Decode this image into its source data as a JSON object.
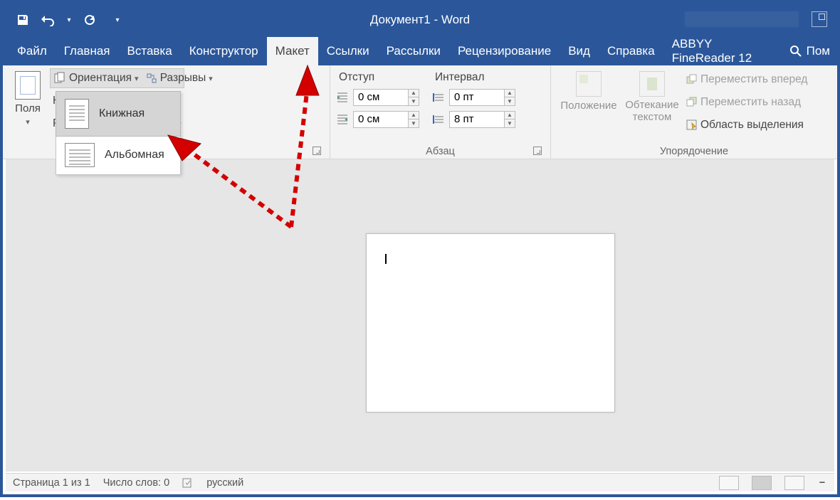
{
  "title": "Документ1  -  Word",
  "qat": {
    "save": "save",
    "undo": "undo",
    "redo": "redo"
  },
  "tabs": [
    "Файл",
    "Главная",
    "Вставка",
    "Конструктор",
    "Макет",
    "Ссылки",
    "Рассылки",
    "Рецензирование",
    "Вид",
    "Справка",
    "ABBYY FineReader 12"
  ],
  "active_tab_index": 4,
  "search_label": "Пом",
  "ribbon": {
    "page_setup": {
      "margins": "Поля",
      "orientation": "Ориентация",
      "breaks": "Разрывы",
      "line_numbers": "Номера строк",
      "hyphenation": "Расстановка переносов",
      "group_label": ""
    },
    "orientation_menu": {
      "portrait": "Книжная",
      "landscape": "Альбомная"
    },
    "paragraph": {
      "indent_label": "Отступ",
      "spacing_label": "Интервал",
      "indent_left": "0 см",
      "indent_right": "0 см",
      "space_before": "0 пт",
      "space_after": "8 пт",
      "group_label": "Абзац"
    },
    "arrange": {
      "position": "Положение",
      "wrap": "Обтекание текстом",
      "bring_forward": "Переместить вперед",
      "send_backward": "Переместить назад",
      "selection_pane": "Область выделения",
      "group_label": "Упорядочение"
    }
  },
  "status": {
    "page": "Страница 1 из 1",
    "words": "Число слов: 0",
    "lang": "русский"
  }
}
